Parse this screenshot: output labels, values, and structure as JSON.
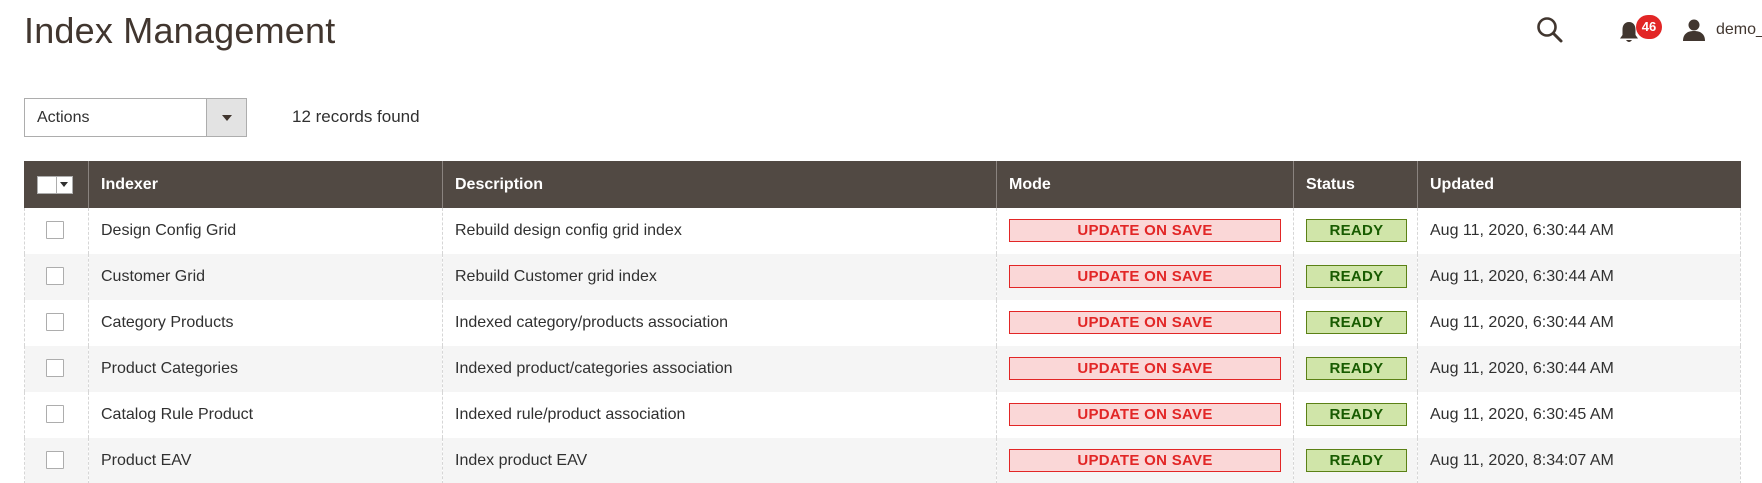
{
  "page": {
    "title": "Index Management"
  },
  "header": {
    "notifications_count": "46",
    "user_name": "demo_admin"
  },
  "toolbar": {
    "actions_label": "Actions",
    "records_found": "12 records found"
  },
  "grid": {
    "columns": [
      "Indexer",
      "Description",
      "Mode",
      "Status",
      "Updated"
    ],
    "rows": [
      {
        "indexer": "Design Config Grid",
        "description": "Rebuild design config grid index",
        "mode": "UPDATE ON SAVE",
        "status": "READY",
        "updated": "Aug 11, 2020, 6:30:44 AM"
      },
      {
        "indexer": "Customer Grid",
        "description": "Rebuild Customer grid index",
        "mode": "UPDATE ON SAVE",
        "status": "READY",
        "updated": "Aug 11, 2020, 6:30:44 AM"
      },
      {
        "indexer": "Category Products",
        "description": "Indexed category/products association",
        "mode": "UPDATE ON SAVE",
        "status": "READY",
        "updated": "Aug 11, 2020, 6:30:44 AM"
      },
      {
        "indexer": "Product Categories",
        "description": "Indexed product/categories association",
        "mode": "UPDATE ON SAVE",
        "status": "READY",
        "updated": "Aug 11, 2020, 6:30:44 AM"
      },
      {
        "indexer": "Catalog Rule Product",
        "description": "Indexed rule/product association",
        "mode": "UPDATE ON SAVE",
        "status": "READY",
        "updated": "Aug 11, 2020, 6:30:45 AM"
      },
      {
        "indexer": "Product EAV",
        "description": "Index product EAV",
        "mode": "UPDATE ON SAVE",
        "status": "READY",
        "updated": "Aug 11, 2020, 8:34:07 AM"
      }
    ]
  },
  "colors": {
    "header_bg": "#514943",
    "mode_text": "#e22626",
    "mode_bg": "#fad7d7",
    "status_text": "#185b00",
    "status_bg": "#d0e5a9",
    "badge_bg": "#e22626"
  }
}
